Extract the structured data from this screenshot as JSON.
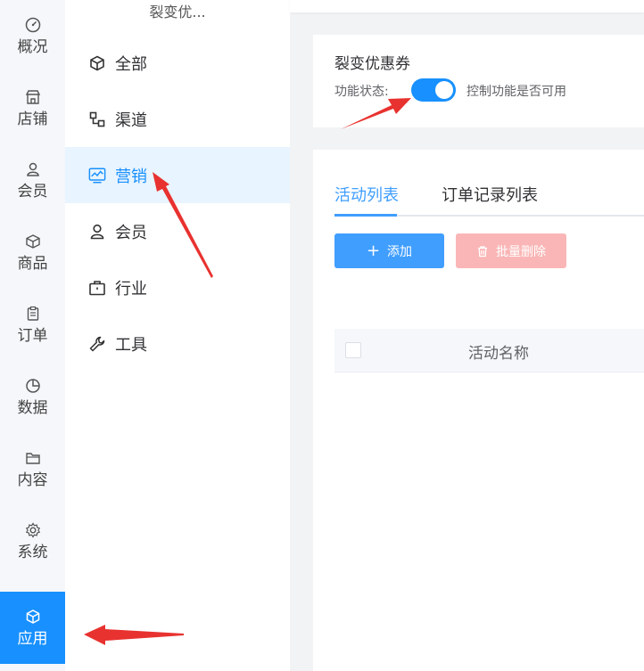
{
  "rail": {
    "items": [
      {
        "label": "概况",
        "icon": "dashboard-icon"
      },
      {
        "label": "店铺",
        "icon": "store-icon"
      },
      {
        "label": "会员",
        "icon": "user-icon"
      },
      {
        "label": "商品",
        "icon": "box-icon"
      },
      {
        "label": "订单",
        "icon": "clipboard-icon"
      },
      {
        "label": "数据",
        "icon": "pie-chart-icon"
      },
      {
        "label": "内容",
        "icon": "folder-icon"
      },
      {
        "label": "系统",
        "icon": "gear-icon"
      },
      {
        "label": "应用",
        "icon": "cube-icon",
        "active": true
      }
    ]
  },
  "submenu": {
    "title": "裂变优...",
    "items": [
      {
        "label": "全部",
        "icon": "cube-icon"
      },
      {
        "label": "渠道",
        "icon": "channel-icon"
      },
      {
        "label": "营销",
        "icon": "marketing-icon",
        "active": true
      },
      {
        "label": "会员",
        "icon": "user-icon"
      },
      {
        "label": "行业",
        "icon": "briefcase-icon"
      },
      {
        "label": "工具",
        "icon": "wrench-icon"
      }
    ]
  },
  "feature": {
    "title": "裂变优惠券",
    "status_label": "功能状态:",
    "enabled": true,
    "status_desc": "控制功能是否可用"
  },
  "tabs": [
    {
      "label": "活动列表",
      "active": true
    },
    {
      "label": "订单记录列表",
      "active": false
    }
  ],
  "actions": {
    "add_label": "添加",
    "batch_delete_label": "批量删除"
  },
  "table": {
    "columns": [
      "活动名称"
    ]
  },
  "colors": {
    "accent": "#409eff",
    "rail_active": "#1890ff",
    "danger_disabled": "#fab6b6",
    "annotation_arrow": "#e8322f"
  }
}
